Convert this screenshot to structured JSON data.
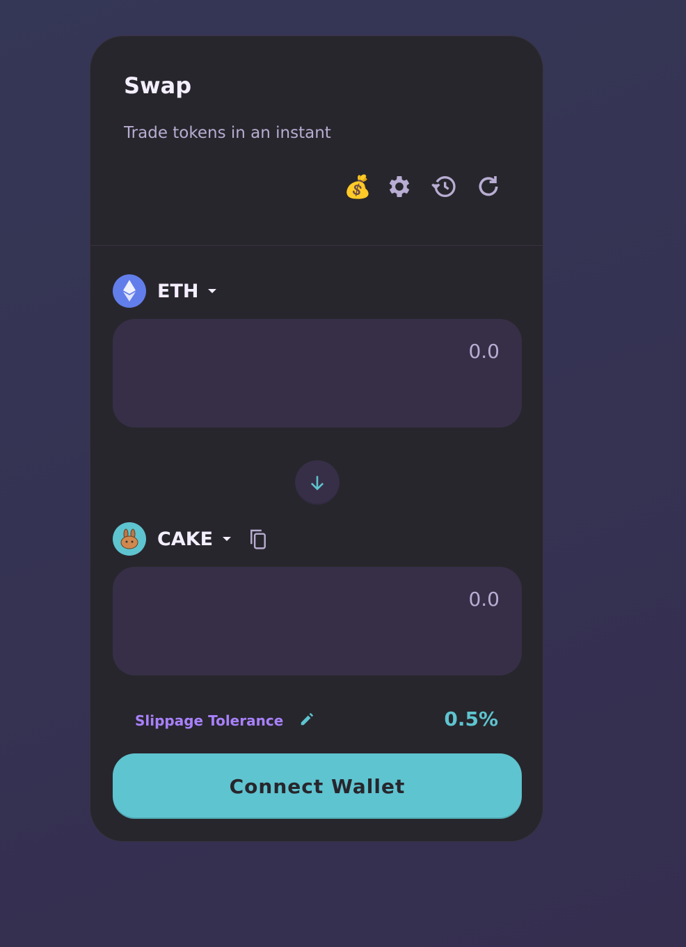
{
  "header": {
    "title": "Swap",
    "subtitle": "Trade tokens in an instant"
  },
  "toolbar": {
    "icons": [
      "money-bag-icon",
      "gear-icon",
      "history-icon",
      "refresh-icon"
    ]
  },
  "from": {
    "symbol": "ETH",
    "value_placeholder": "0.0"
  },
  "to": {
    "symbol": "CAKE",
    "value_placeholder": "0.0"
  },
  "slippage": {
    "label": "Slippage Tolerance",
    "value": "0.5%"
  },
  "connect_label": "Connect Wallet",
  "colors": {
    "accent": "#5ec4d0",
    "purple": "#a881fc",
    "card": "#27262c",
    "input": "#372f47"
  }
}
